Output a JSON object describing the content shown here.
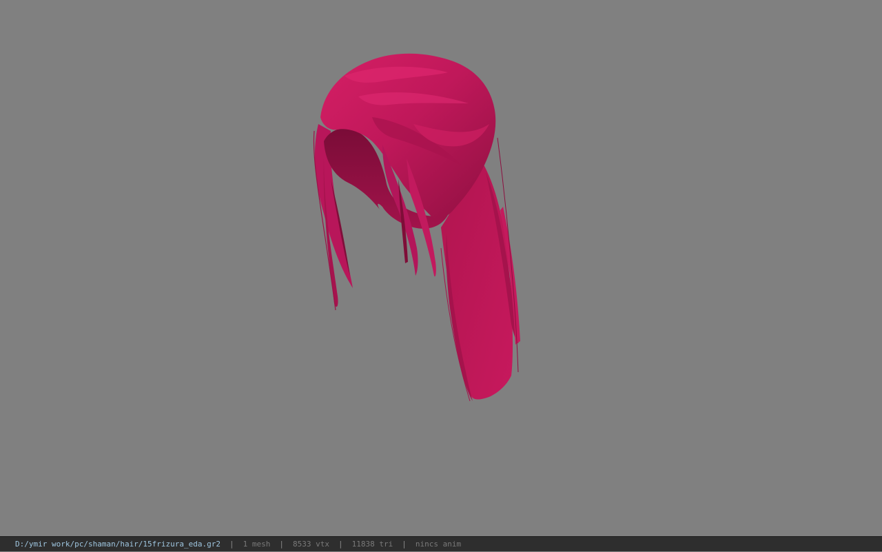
{
  "viewport": {
    "background": "#808080",
    "model_color": "#c0185a"
  },
  "status_bar": {
    "file_path": "D:/ymir work/pc/shaman/hair/15frizura_eda.gr2",
    "separator": "|",
    "mesh_count": "1 mesh",
    "vertex_count": "8533 vtx",
    "triangle_count": "11838 tri",
    "animation_status": "nincs anim"
  }
}
